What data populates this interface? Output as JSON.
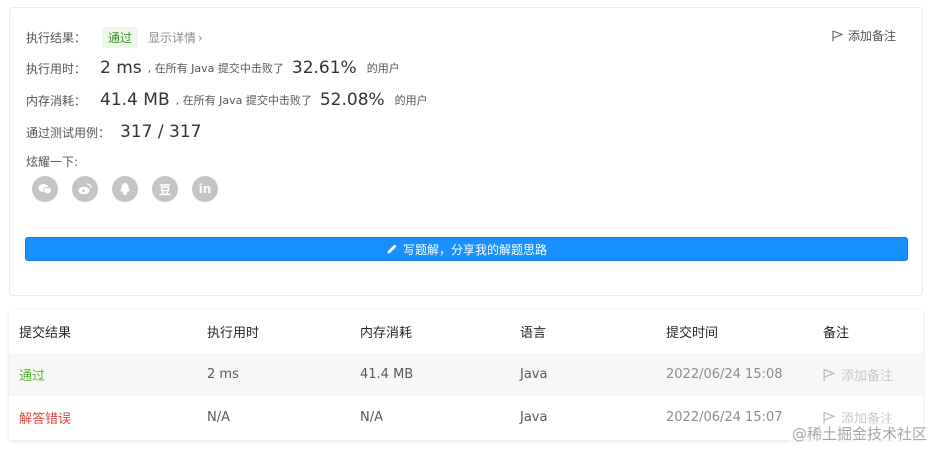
{
  "result": {
    "exec_label": "执行结果：",
    "status": "通过",
    "detail_link": "显示详情",
    "add_note": "添加备注",
    "runtime_label": "执行用时：",
    "runtime_value": "2 ms",
    "runtime_text": ", 在所有 Java 提交中击败了",
    "runtime_pct": "32.61%",
    "runtime_suffix": "的用户",
    "memory_label": "内存消耗：",
    "memory_value": "41.4 MB",
    "memory_text": ", 在所有 Java 提交中击败了",
    "memory_pct": "52.08%",
    "memory_suffix": "的用户",
    "tests_label": "通过测试用例：",
    "tests_value": "317 / 317",
    "share_label": "炫耀一下:",
    "share_icons": [
      "wechat-icon",
      "weibo-icon",
      "qq-icon",
      "douban-icon",
      "linkedin-icon"
    ],
    "douban_glyph": "豆",
    "linkedin_glyph": "in",
    "write_button": "写题解，分享我的解题思路"
  },
  "table": {
    "headers": [
      "提交结果",
      "执行用时",
      "内存消耗",
      "语言",
      "提交时间",
      "备注"
    ],
    "rows": [
      {
        "result": "通过",
        "runtime": "2 ms",
        "memory": "41.4 MB",
        "language": "Java",
        "time": "2022/06/24 15:08",
        "note": "添加备注"
      },
      {
        "result": "解答错误",
        "runtime": "N/A",
        "memory": "N/A",
        "language": "Java",
        "time": "2022/06/24 15:07",
        "note": "添加备注"
      }
    ]
  },
  "watermark": "@稀土掘金技术社区",
  "colors": {
    "accent": "#1890ff",
    "pass": "#5cb537",
    "fail": "#e04545"
  }
}
